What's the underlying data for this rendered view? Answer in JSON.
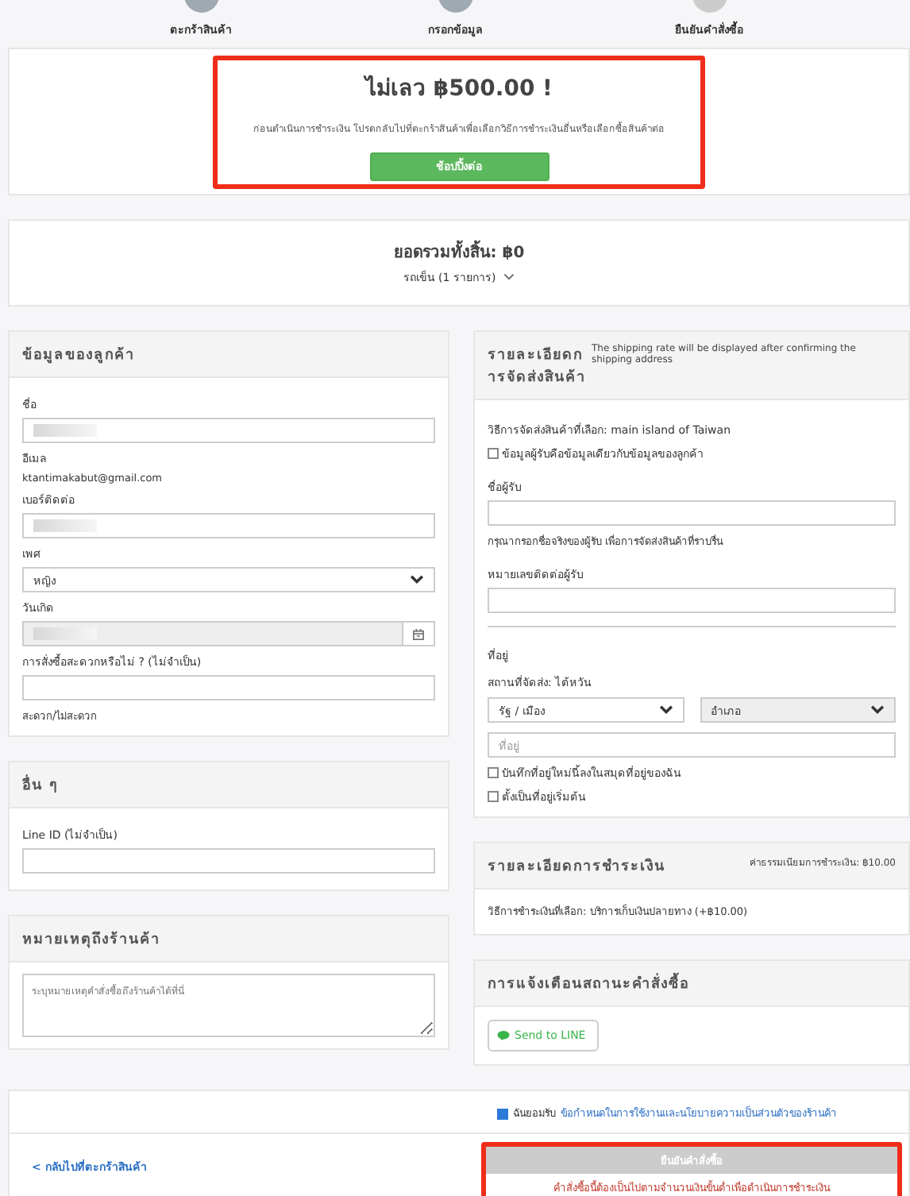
{
  "steps": [
    {
      "label": "ตะกร้าสินค้า",
      "completed": true
    },
    {
      "label": "กรอกข้อมูล",
      "completed": true
    },
    {
      "label": "ยืนยันคำสั่งซื้อ",
      "completed": false
    }
  ],
  "alert": {
    "highlighted": true,
    "title": "ไม่เลว ฿500.00 !",
    "message": "ก่อนดำเนินการชำระเงิน โปรดกลับไปที่ตะกร้าสินค้าเพื่อเลือกวิธีการชำระเงินอื่นหรือเลือกซื้อสินค้าต่อ",
    "button": "ช้อปปิ้งต่อ"
  },
  "total": {
    "label": "ยอดรวมทั้งสิ้น: ฿0",
    "cart_summary": "รถเข็น (1 รายการ)",
    "expanded": false
  },
  "customer": {
    "title": "ข้อมูลของลูกค้า",
    "fields": [
      {
        "kind": "input",
        "label": "ชื่อ",
        "redacted": true
      },
      {
        "kind": "static",
        "label": "อีเมล",
        "value": "ktantimakabut@gmail.com"
      },
      {
        "kind": "input",
        "label": "เบอร์ติดต่อ",
        "redacted": true
      },
      {
        "kind": "select",
        "label": "เพศ",
        "value": "หญิง"
      },
      {
        "kind": "date",
        "label": "วันเกิด",
        "redacted": true
      },
      {
        "kind": "input",
        "label": "การสั่งซื้อสะดวกหรือไม่ ? (ไม่จำเป็น)",
        "hint": "สะดวก/ไม่สะดวก"
      }
    ]
  },
  "others": {
    "title": "อื่น ๆ",
    "fields": [
      {
        "kind": "input",
        "label": "Line ID (ไม่จำเป็น)"
      }
    ]
  },
  "notes": {
    "title": "หมายเหตุถึงร้านค้า",
    "placeholder": "ระบุหมายเหตุคำสั่งซื้อถึงร้านค้าได้ที่นี่"
  },
  "shipping": {
    "title": "รายละเอียดการจัดส่งสินค้า",
    "note": "The shipping rate will be displayed after confirming the shipping address",
    "items": [
      {
        "kind": "text",
        "text": "วิธีการจัดส่งสินค้าที่เลือก: main island of Taiwan"
      },
      {
        "kind": "checkbox",
        "label": "ข้อมูลผู้รับคือข้อมูลเดียวกับข้อมูลของลูกค้า",
        "checked": false
      },
      {
        "kind": "input",
        "label": "ชื่อผู้รับ",
        "hint": "กรุณากรอกชื่อจริงของผู้รับ เพื่อการจัดส่งสินค้าที่ราบรื่น"
      },
      {
        "kind": "input",
        "label": "หมายเลขติดต่อผู้รับ"
      },
      {
        "kind": "divider"
      },
      {
        "kind": "text",
        "text": "ที่อยู่"
      },
      {
        "kind": "text",
        "text": "สถานที่จัดส่ง: ไต้หวัน"
      },
      {
        "kind": "selects",
        "options": [
          {
            "value": "รัฐ / เมือง",
            "disabled": false
          },
          {
            "value": "อำเภอ",
            "disabled": true
          }
        ]
      },
      {
        "kind": "input",
        "placeholder": "ที่อยู่"
      },
      {
        "kind": "checkbox",
        "label": "บันทึกที่อยู่ใหม่นี้ลงในสมุดที่อยู่ของฉัน",
        "checked": false
      },
      {
        "kind": "checkbox",
        "label": "ตั้งเป็นที่อยู่เริ่มต้น",
        "checked": false
      }
    ]
  },
  "payment": {
    "title": "รายละเอียดการชำระเงิน",
    "fee": "ค่าธรรมเนียมการชำระเงิน: ฿10.00",
    "method": "วิธีการชำระเงินที่เลือก: บริการเก็บเงินปลายทาง (+฿10.00)"
  },
  "notification": {
    "title": "การแจ้งเตือนสถานะคำสั่งซื้อ",
    "button": "Send to LINE"
  },
  "footer": {
    "terms": {
      "checked": true,
      "text": "ฉันยอมรับ",
      "link": "ข้อกำหนดในการใช้งานและนโยบายความเป็นส่วนตัวของร้านค้า"
    },
    "back_link": "< กลับไปที่ตะกร้าสินค้า",
    "confirm": {
      "label": "ยืนยันคำสั่งซื้อ",
      "disabled": true,
      "highlighted": true
    },
    "error": "คำสั่งซื้อนี้ต้องเป็นไปตามจำนวนเงินขั้นต่ำเพื่อดำเนินการชำระเงิน"
  }
}
